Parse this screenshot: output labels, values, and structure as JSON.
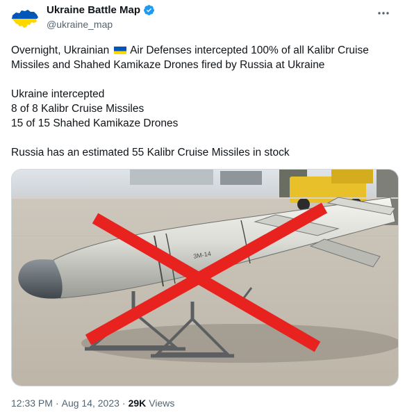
{
  "author": {
    "display_name": "Ukraine Battle Map",
    "handle": "@ukraine_map"
  },
  "tweet": {
    "line1_before_flag": "Overnight, Ukrainian",
    "line1_after_flag": "Air Defenses intercepted 100% of all Kalibr Cruise Missiles and Shahed Kamikaze Drones fired by Russia at Ukraine",
    "para2_l1": "Ukraine intercepted",
    "para2_l2": "8 of 8 Kalibr Cruise Missiles",
    "para2_l3": "15 of 15 Shahed Kamikaze Drones",
    "para3": "Russia has an estimated 55 Kalibr Cruise Missiles in stock"
  },
  "media": {
    "missile_marking": "3M-14"
  },
  "meta": {
    "time": "12:33 PM",
    "sep1": "·",
    "date": "Aug 14, 2023",
    "sep2": "·",
    "views_count": "29K",
    "views_label": "Views"
  },
  "colors": {
    "flag_blue": "#0057b7",
    "flag_yellow": "#ffd700",
    "verified_blue": "#1d9bf0",
    "cross_red": "#e8231f"
  },
  "icons": {
    "avatar": "ukraine-map-avatar",
    "verified": "verified-badge-icon",
    "more": "more-options-icon",
    "flag": "ukraine-flag-icon"
  }
}
